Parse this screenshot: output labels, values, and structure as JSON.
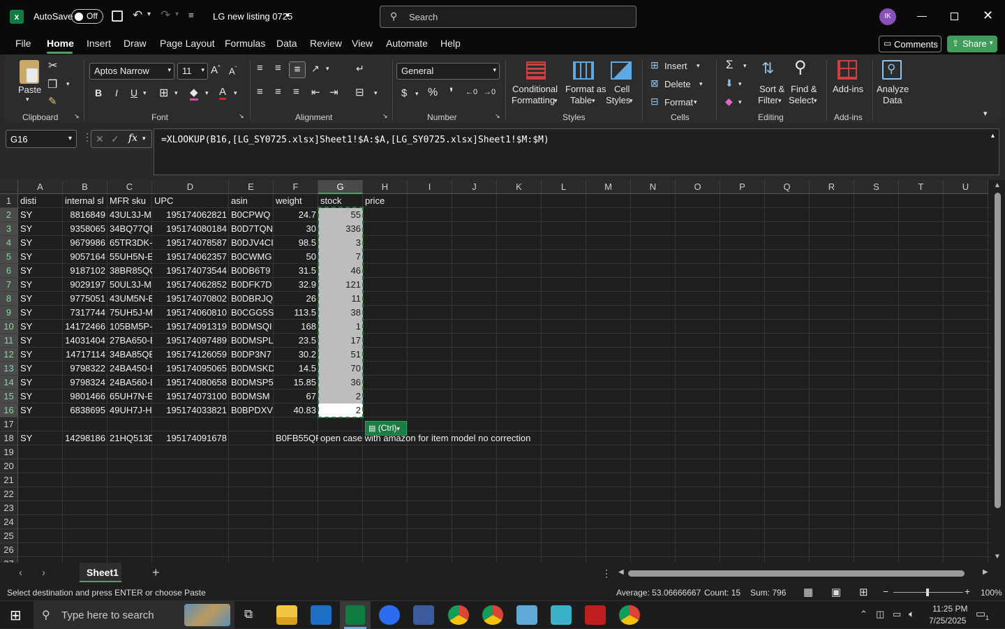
{
  "title_bar": {
    "autosave_label": "AutoSave",
    "autosave_state": "Off",
    "doc_title": "LG new listing 0725",
    "search_placeholder": "Search",
    "avatar_initials": "IK"
  },
  "menu": {
    "items": [
      "File",
      "Home",
      "Insert",
      "Draw",
      "Page Layout",
      "Formulas",
      "Data",
      "Review",
      "View",
      "Automate",
      "Help"
    ],
    "comments": "Comments",
    "share": "Share"
  },
  "ribbon": {
    "clipboard": {
      "paste": "Paste",
      "label": "Clipboard"
    },
    "font": {
      "name": "Aptos Narrow",
      "size": "11",
      "label": "Font",
      "bold": "B",
      "italic": "I",
      "underline": "U"
    },
    "alignment": {
      "label": "Alignment"
    },
    "number": {
      "format": "General",
      "label": "Number",
      "currency": "$",
      "percent": "%"
    },
    "styles": {
      "conditional": "Conditional",
      "conditional2": "Formatting",
      "format_as": "Format as",
      "format_as2": "Table",
      "cell": "Cell",
      "cell2": "Styles",
      "label": "Styles"
    },
    "cells": {
      "insert": "Insert",
      "delete": "Delete",
      "format": "Format",
      "label": "Cells"
    },
    "editing": {
      "sort": "Sort &",
      "sort2": "Filter",
      "find": "Find &",
      "find2": "Select",
      "label": "Editing",
      "sigma": "Σ"
    },
    "addins": {
      "addins": "Add-ins",
      "label": "Add-ins",
      "analyze": "Analyze",
      "analyze2": "Data"
    }
  },
  "formula_bar": {
    "name_box": "G16",
    "fx": "fx",
    "formula": "=XLOOKUP(B16,[LG_SY0725.xlsx]Sheet1!$A:$A,[LG_SY0725.xlsx]Sheet1!$M:$M)"
  },
  "columns": [
    "A",
    "B",
    "C",
    "D",
    "E",
    "F",
    "G",
    "H",
    "I",
    "J",
    "K",
    "L",
    "M",
    "N",
    "O",
    "P",
    "Q",
    "R",
    "S",
    "T",
    "U"
  ],
  "rows": [
    "1",
    "2",
    "3",
    "4",
    "5",
    "6",
    "7",
    "8",
    "9",
    "10",
    "11",
    "12",
    "13",
    "14",
    "15",
    "16",
    "17",
    "18",
    "19",
    "20",
    "21",
    "22",
    "23",
    "24",
    "25",
    "26",
    "27"
  ],
  "headers": {
    "A": "disti",
    "B": "internal sl",
    "C": "MFR sku",
    "D": "UPC",
    "E": "asin",
    "F": "weight",
    "G": "stock",
    "H": "price"
  },
  "data": [
    [
      "SY",
      "8816849",
      "43UL3J-M",
      "195174062821",
      "B0CPWQ",
      "24.7",
      "55"
    ],
    [
      "SY",
      "9358065",
      "34BQ77QE",
      "195174080184",
      "B0D7TQN",
      "30",
      "336"
    ],
    [
      "SY",
      "9679986",
      "65TR3DK-E",
      "195174078587",
      "B0DJV4CI",
      "98.5",
      "3"
    ],
    [
      "SY",
      "9057164",
      "55UH5N-E",
      "195174062357",
      "B0CWMG",
      "50",
      "7"
    ],
    [
      "SY",
      "9187102",
      "38BR85QC",
      "195174073544",
      "B0DB6T9",
      "31.5",
      "46"
    ],
    [
      "SY",
      "9029197",
      "50UL3J-M",
      "195174062852",
      "B0DFK7D",
      "32.9",
      "121"
    ],
    [
      "SY",
      "9775051",
      "43UM5N-E",
      "195174070802",
      "B0DBRJQ",
      "26",
      "11"
    ],
    [
      "SY",
      "7317744",
      "75UH5J-M",
      "195174060810",
      "B0CGG5S",
      "113.5",
      "38"
    ],
    [
      "SY",
      "14172466",
      "105BM5P-",
      "195174091319",
      "B0DMSQI",
      "168",
      "1"
    ],
    [
      "SY",
      "14031404",
      "27BA650-E",
      "195174097489",
      "B0DMSPL",
      "23.5",
      "17"
    ],
    [
      "SY",
      "14717114",
      "34BA85QE",
      "195174126059",
      "B0DP3N7",
      "30.2",
      "51"
    ],
    [
      "SY",
      "9798322",
      "24BA450-E",
      "195174095065",
      "B0DMSKD",
      "14.5",
      "70"
    ],
    [
      "SY",
      "9798324",
      "24BA560-E",
      "195174080658",
      "B0DMSP5",
      "15.85",
      "36"
    ],
    [
      "SY",
      "9801466",
      "65UH7N-E",
      "195174073100",
      "B0DMSM",
      "67",
      "2"
    ],
    [
      "SY",
      "6838695",
      "49UH7J-H",
      "195174033821",
      "B0BPDXV",
      "40.83",
      "2"
    ]
  ],
  "row18": {
    "A": "SY",
    "B": "14298186",
    "C": "21HQ513D",
    "D": "195174091678",
    "F": "B0FB55QP",
    "G": "open case with amazon for item model no correction"
  },
  "paste_ctrl": "(Ctrl)",
  "sheet_tab": "Sheet1",
  "status": {
    "message": "Select destination and press ENTER or choose Paste",
    "average": "Average: 53.06666667",
    "count": "Count: 15",
    "sum": "Sum: 796",
    "zoom": "100%"
  },
  "taskbar": {
    "search_placeholder": "Type here to search",
    "time": "11:25 PM",
    "date": "7/25/2025",
    "notif": "1"
  }
}
